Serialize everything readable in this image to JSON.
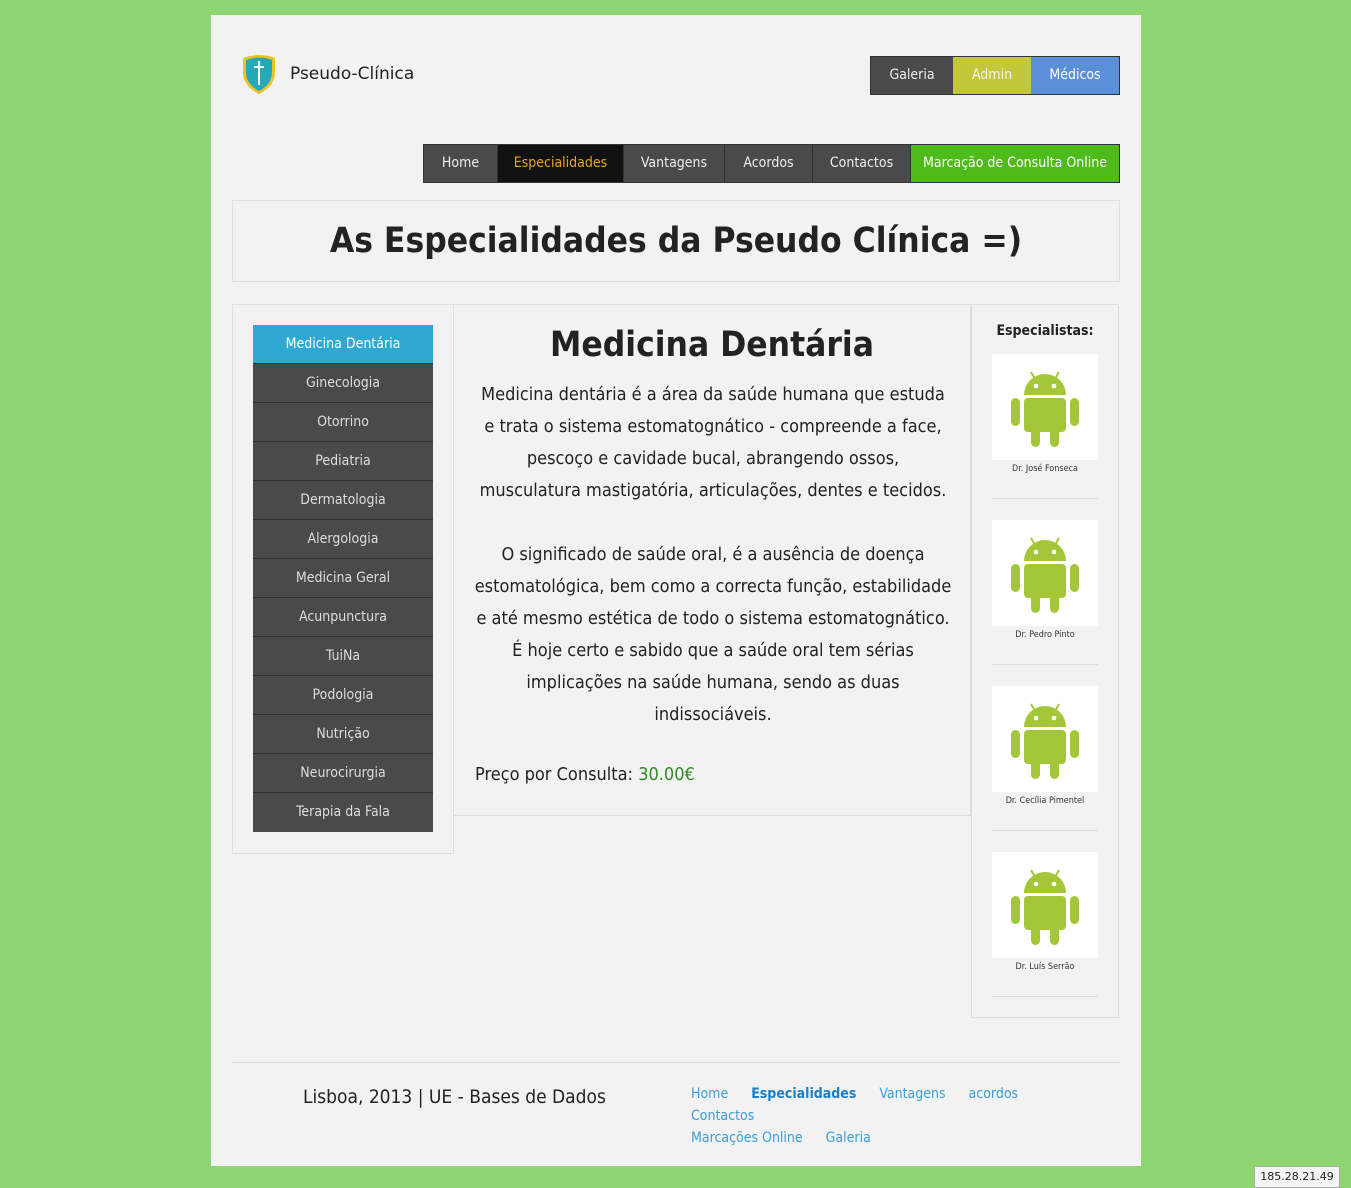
{
  "header": {
    "logo_text": "Pseudo-Clínica",
    "top_nav": {
      "galeria": "Galeria",
      "admin": "Admin",
      "medicos": "Médicos"
    },
    "main_nav": {
      "home": "Home",
      "especialidades": "Especialidades",
      "vantagens": "Vantagens",
      "acordos": "Acordos",
      "contactos": "Contactos",
      "marcacao": "Marcação de Consulta Online"
    }
  },
  "headline": "As Especialidades da Pseudo Clínica =)",
  "specialties": [
    "Medicina Dentária",
    "Ginecologia",
    "Otorrino",
    "Pediatria",
    "Dermatologia",
    "Alergologia",
    "Medicina Geral",
    "Acunpunctura",
    "TuiNa",
    "Podologia",
    "Nutrição",
    "Neurocirurgia",
    "Terapia da Fala"
  ],
  "content": {
    "title": "Medicina Dentária",
    "paragraph1": "Medicina dentária é a área da saúde humana que estuda e trata o sistema estomatognático - compreende a face, pescoço e cavidade bucal, abrangendo ossos, musculatura mastigatória, articulações, dentes e tecidos.",
    "paragraph2": "O significado de saúde oral, é a ausência de doença estomatológica, bem como a correcta função, estabilidade e até mesmo estética de todo o sistema estomatognático. É hoje certo e sabido que a saúde oral tem sérias implicações na saúde humana, sendo as duas indissociáveis.",
    "price_label": "Preço por Consulta:",
    "price_value": "30.00€"
  },
  "specialists": {
    "title": "Especialistas:",
    "doctors": [
      "Dr. José Fonseca",
      "Dr. Pedro Pinto",
      "Dr. Cecília Pimentel",
      "Dr. Luís Serrão"
    ]
  },
  "footer": {
    "text": "Lisboa, 2013 | UE - Bases de Dados",
    "links": [
      "Home",
      "Especialidades",
      "Vantagens",
      "acordos",
      "Contactos",
      "Marcações Online",
      "Galeria"
    ]
  },
  "ip_badge": "185.28.21.49",
  "colors": {
    "background": "#8fd672",
    "active_specialty": "#31a8d0",
    "active_nav_text": "#f0a020",
    "online_booking": "#4fbb1a",
    "admin": "#c2c83a",
    "medicos": "#5b8fd7",
    "price": "#2e8b20",
    "android": "#a4c639"
  }
}
